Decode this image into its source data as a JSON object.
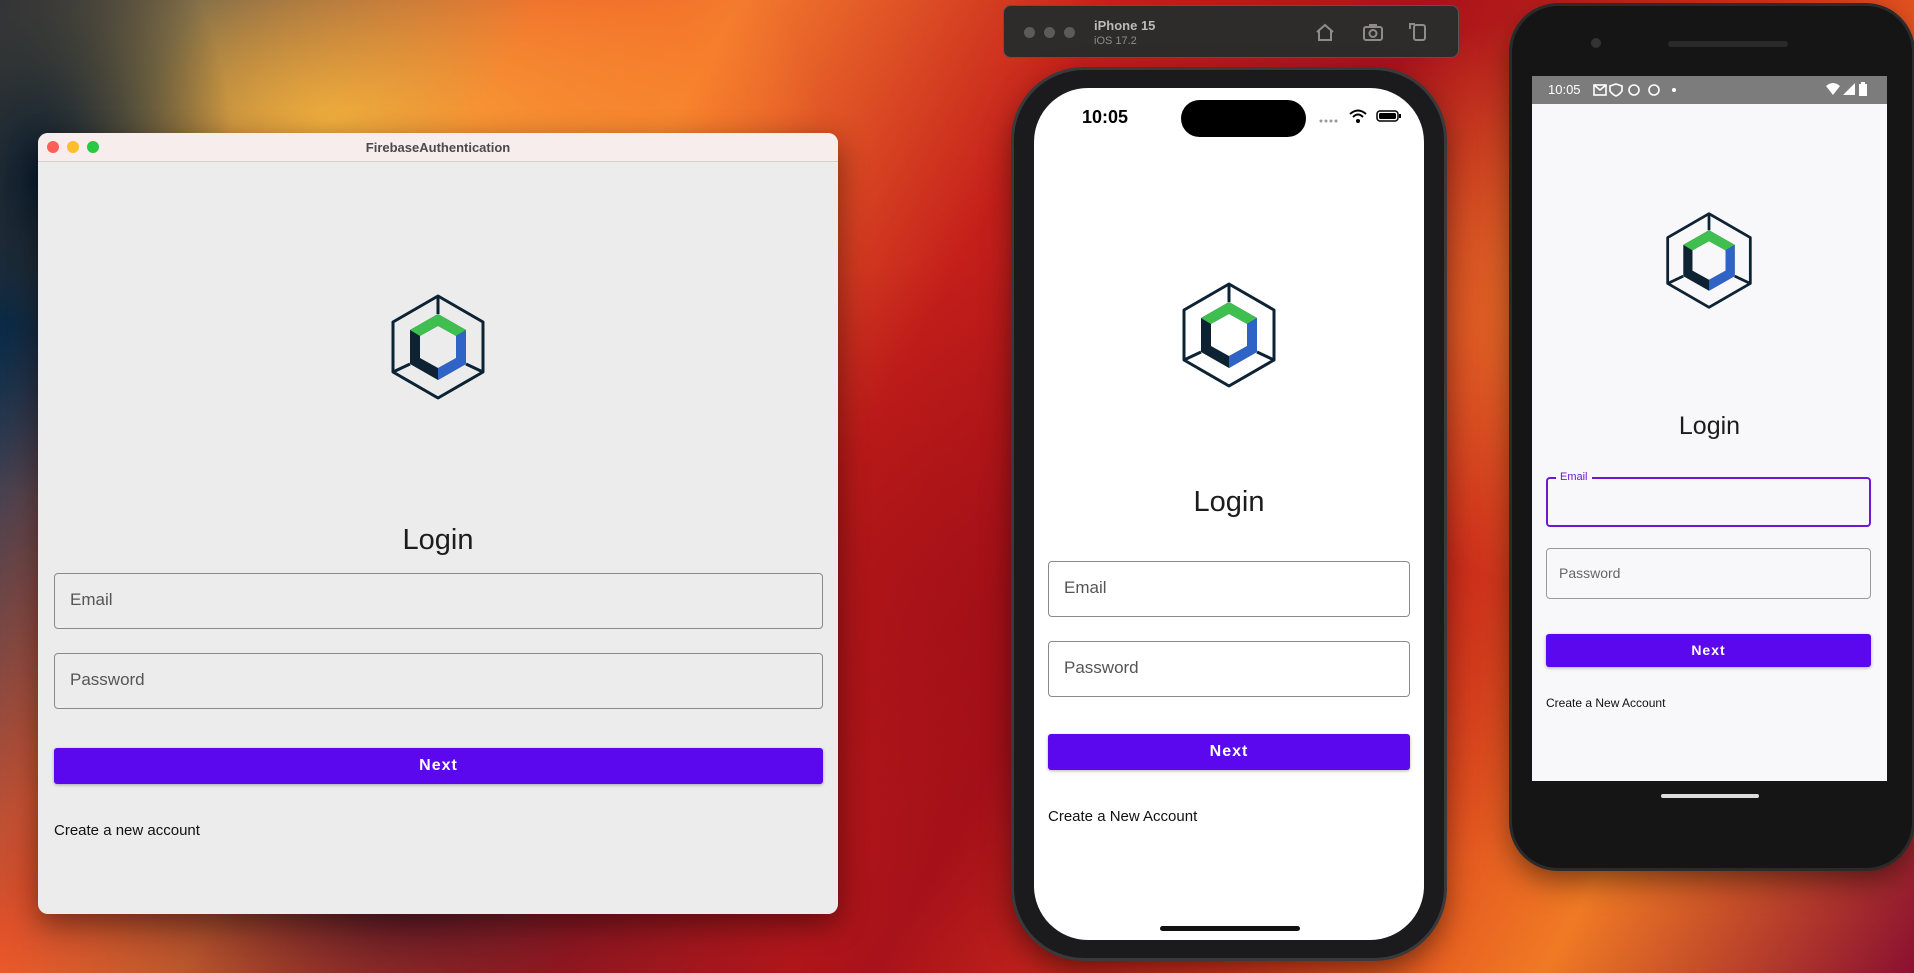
{
  "desktop_app": {
    "window_title": "FirebaseAuthentication",
    "heading": "Login",
    "email_placeholder": "Email",
    "password_placeholder": "Password",
    "next_label": "Next",
    "create_account_label": "Create a new account"
  },
  "ios_simulator": {
    "toolbar": {
      "device_name": "iPhone 15",
      "os_version": "iOS 17.2"
    },
    "status_time": "10:05",
    "heading": "Login",
    "email_placeholder": "Email",
    "password_placeholder": "Password",
    "next_label": "Next",
    "create_account_label": "Create a New Account"
  },
  "android_emulator": {
    "status_time": "10:05",
    "heading": "Login",
    "email_label": "Email",
    "password_placeholder": "Password",
    "next_label": "Next",
    "create_account_label": "Create a New Account"
  },
  "colors": {
    "primary_button": "#5b08ee",
    "focused_field": "#6a1bd1",
    "logo_green": "#3fbf4f",
    "logo_blue": "#2f63c6",
    "logo_dark": "#0d2333"
  }
}
